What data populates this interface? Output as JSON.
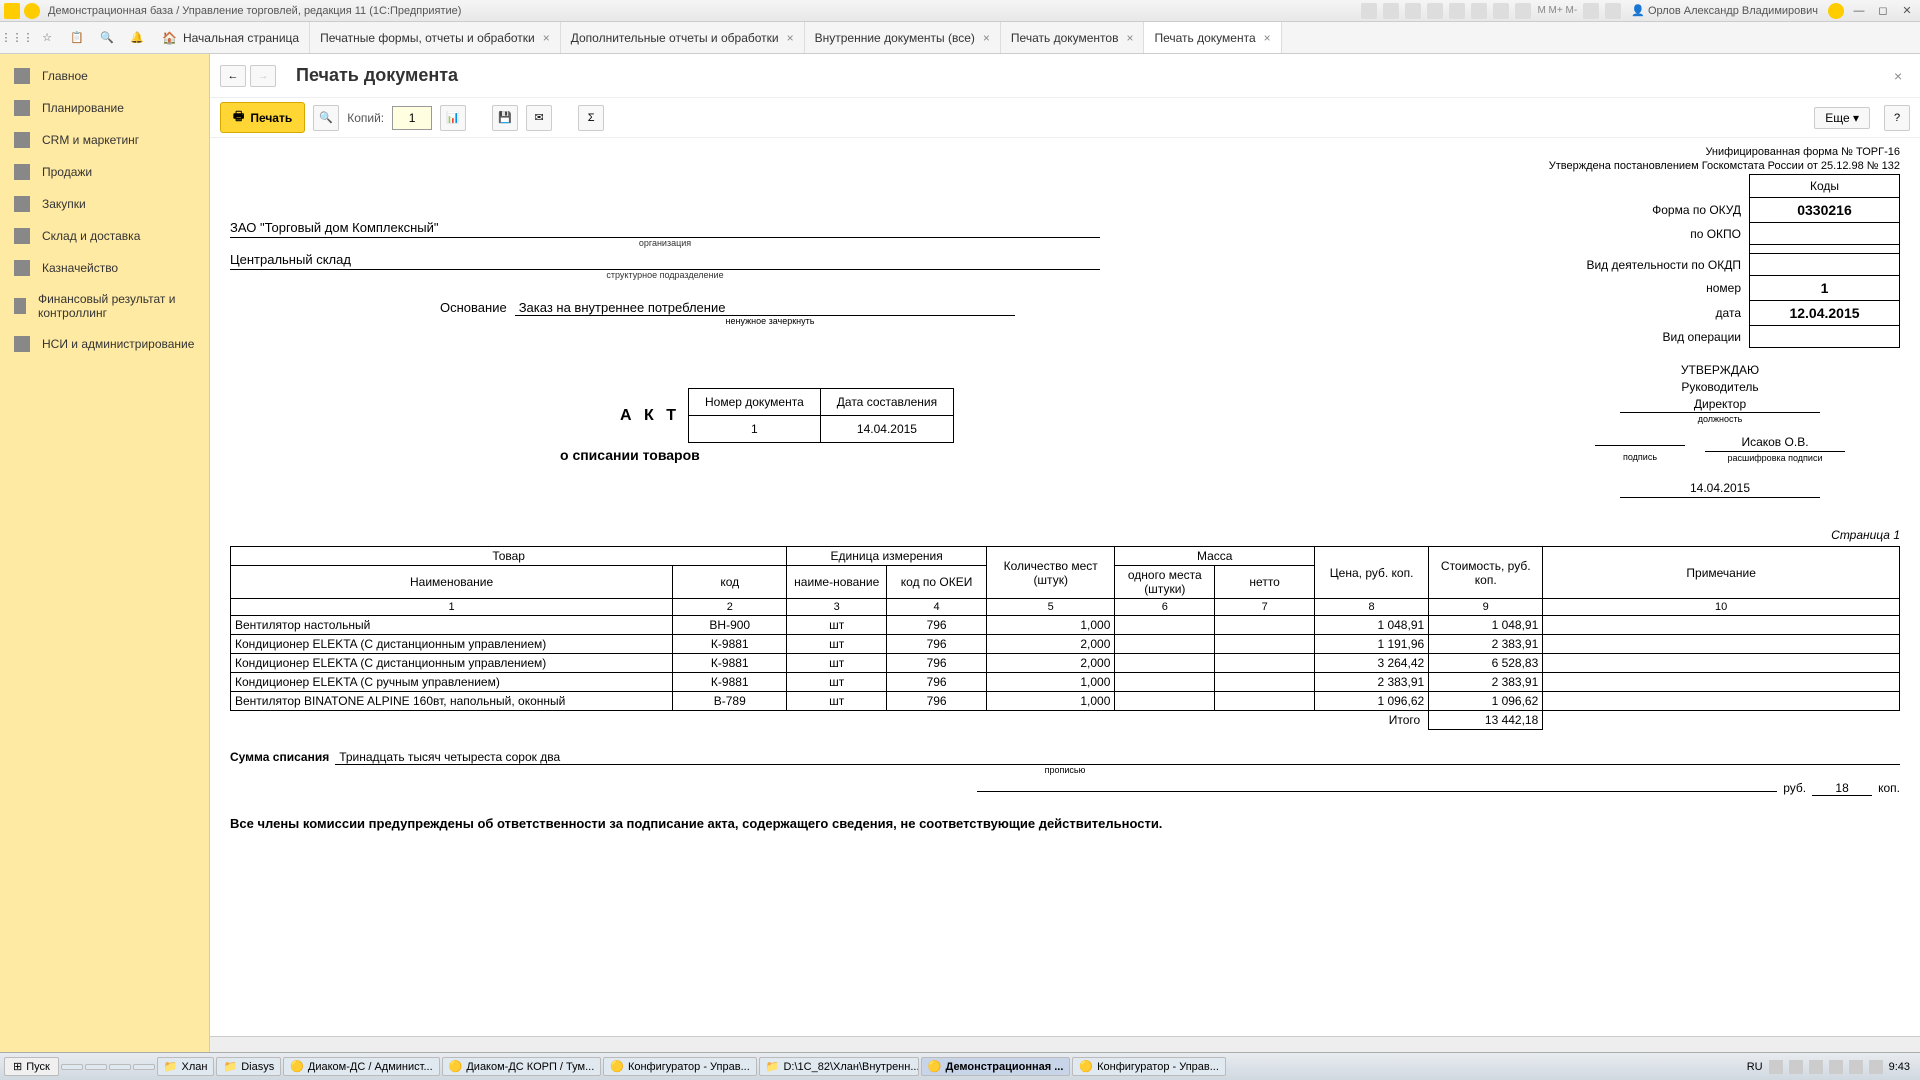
{
  "titlebar": {
    "title": "Демонстрационная база / Управление торговлей, редакция 11  (1С:Предприятие)",
    "user": "Орлов Александр Владимирович"
  },
  "tabs": {
    "home": "Начальная страница",
    "t1": "Печатные формы, отчеты и обработки",
    "t2": "Дополнительные отчеты и обработки",
    "t3": "Внутренние документы (все)",
    "t4": "Печать документов",
    "t5": "Печать документа"
  },
  "sidebar": {
    "items": [
      "Главное",
      "Планирование",
      "CRM и маркетинг",
      "Продажи",
      "Закупки",
      "Склад и доставка",
      "Казначейство",
      "Финансовый результат и контроллинг",
      "НСИ и администрирование"
    ]
  },
  "header": {
    "page_title": "Печать документа",
    "print_label": "Печать",
    "copies_label": "Копий:",
    "copies_value": "1",
    "more_label": "Еще",
    "help": "?"
  },
  "doc": {
    "form_line1": "Унифицированная форма № ТОРГ-16",
    "form_line2": "Утверждена постановлением Госкомстата России от 25.12.98 № 132",
    "codes_header": "Коды",
    "okud_label": "Форма по ОКУД",
    "okud_value": "0330216",
    "okpo_label": "по ОКПО",
    "okdp_label": "Вид деятельности по ОКДП",
    "number_label": "номер",
    "number_value": "1",
    "date_label": "дата",
    "date_value": "12.04.2015",
    "op_label": "Вид операции",
    "org": "ЗАО \"Торговый дом Комплексный\"",
    "org_caption": "организация",
    "dept": "Центральный склад",
    "dept_caption": "структурное подразделение",
    "basis_label": "Основание",
    "basis_value": "Заказ на внутреннее потребление",
    "basis_caption": "ненужное зачеркнуть",
    "approve": "УТВЕРЖДАЮ",
    "approve_role": "Руководитель",
    "approve_pos": "Директор",
    "approve_pos_caption": "должность",
    "approve_sign_caption": "подпись",
    "approve_name": "Исаков О.В.",
    "approve_name_caption": "расшифровка подписи",
    "approve_date": "14.04.2015",
    "act_label": "А К Т",
    "act_col1": "Номер документа",
    "act_col2": "Дата составления",
    "act_num": "1",
    "act_date": "14.04.2015",
    "act_subtitle": "о списании товаров",
    "page_num": "Страница 1",
    "th_goods": "Товар",
    "th_name": "Наименование",
    "th_code": "код",
    "th_unit": "Единица измерения",
    "th_unit_name": "наиме-нование",
    "th_unit_okei": "код по ОКЕИ",
    "th_qty": "Количество мест (штук)",
    "th_mass": "Масса",
    "th_mass_one": "одного места (штуки)",
    "th_mass_net": "нетто",
    "th_price": "Цена, руб. коп.",
    "th_cost": "Стоимость, руб. коп.",
    "th_note": "Примечание",
    "rows": [
      {
        "name": "Вентилятор настольный",
        "code": "ВН-900",
        "unit": "шт",
        "okei": "796",
        "qty": "1,000",
        "price": "1 048,91",
        "cost": "1 048,91"
      },
      {
        "name": "Кондиционер ELEKTA (С дистанционным управлением)",
        "code": "К-9881",
        "unit": "шт",
        "okei": "796",
        "qty": "2,000",
        "price": "1 191,96",
        "cost": "2 383,91"
      },
      {
        "name": "Кондиционер ELEKTA (С дистанционным управлением)",
        "code": "К-9881",
        "unit": "шт",
        "okei": "796",
        "qty": "2,000",
        "price": "3 264,42",
        "cost": "6 528,83"
      },
      {
        "name": "Кондиционер ELEKTA (С ручным управлением)",
        "code": "К-9881",
        "unit": "шт",
        "okei": "796",
        "qty": "1,000",
        "price": "2 383,91",
        "cost": "2 383,91"
      },
      {
        "name": "Вентилятор BINATONE ALPINE 160вт, напольный, оконный",
        "code": "В-789",
        "unit": "шт",
        "okei": "796",
        "qty": "1,000",
        "price": "1 096,62",
        "cost": "1 096,62"
      }
    ],
    "total_label": "Итого",
    "total_value": "13 442,18",
    "sum_label": "Сумма списания",
    "sum_words": "Тринадцать тысяч четыреста сорок два",
    "sum_caption": "прописью",
    "rub_label": "руб.",
    "rub_value": "18",
    "kop_label": "коп.",
    "warning": "Все члены комиссии предупреждены об ответственности за подписание акта, содержащего сведения, не соответствующие действительности."
  },
  "taskbar": {
    "start": "Пуск",
    "items": [
      "Хлан",
      "Diasys",
      "Диаком-ДС / Админист...",
      "Диаком-ДС КОРП / Тум...",
      "Конфигуратор - Управ...",
      "D:\\1С_82\\Хлан\\Внутренн...",
      "Демонстрационная ...",
      "Конфигуратор - Управ..."
    ],
    "lang": "RU",
    "clock": "9:43"
  }
}
